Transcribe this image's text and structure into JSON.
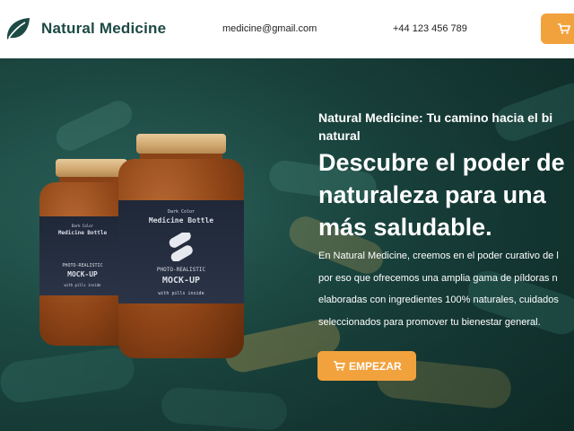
{
  "header": {
    "brand": "Natural Medicine",
    "email": "medicine@gmail.com",
    "phone": "+44 123 456 789",
    "cart_icon": "cart-icon",
    "logo_icon": "leaf-icon"
  },
  "hero": {
    "tagline_line1": "Natural Medicine: Tu camino hacia el bi",
    "tagline_line2": "natural",
    "headline_line1": "Descubre el poder de",
    "headline_line2": "naturaleza para una",
    "headline_line3": "más saludable.",
    "desc_line1": "En Natural Medicine, creemos en el poder curativo de l",
    "desc_line2": "por eso que ofrecemos una amplia gama de píldoras n",
    "desc_line3": "elaboradas con ingredientes 100% naturales, cuidados",
    "desc_line4": "seleccionados para promover tu bienestar general.",
    "cta_label": "EMPEZAR",
    "cta_icon": "cart-icon"
  },
  "product_mockup": {
    "front": {
      "line1": "Dark Color",
      "line2": "Medicine Bottle",
      "line3": "PHOTO-REALISTIC",
      "line4": "MOCK-UP",
      "line5": "with pills inside"
    },
    "back": {
      "line1": "Dark Color",
      "line2": "Medicine Bottle",
      "line3": "PHOTO-REALISTIC",
      "line4": "MOCK-UP",
      "line5": "with pills inside"
    }
  },
  "colors": {
    "brand_green": "#1d4a45",
    "accent_orange": "#f2a23d",
    "hero_bg": "#1e4b45"
  }
}
